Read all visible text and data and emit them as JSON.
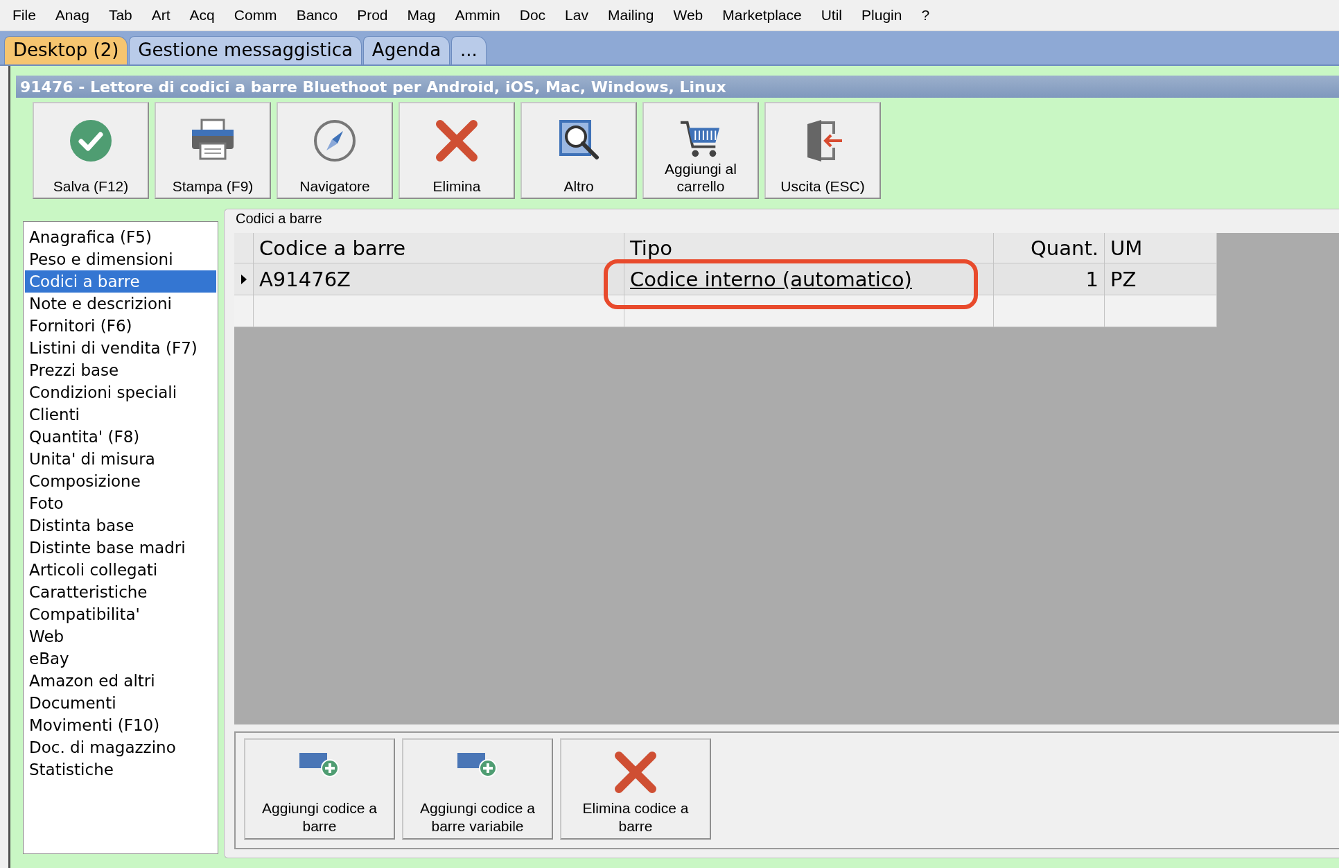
{
  "menu": [
    "File",
    "Anag",
    "Tab",
    "Art",
    "Acq",
    "Comm",
    "Banco",
    "Prod",
    "Mag",
    "Ammin",
    "Doc",
    "Lav",
    "Mailing",
    "Web",
    "Marketplace",
    "Util",
    "Plugin",
    "?"
  ],
  "tabs": [
    {
      "label": "Desktop (2)",
      "selected": true
    },
    {
      "label": "Gestione messaggistica",
      "selected": false
    },
    {
      "label": "Agenda",
      "selected": false
    },
    {
      "label": "...",
      "selected": false
    }
  ],
  "window": {
    "title": "91476 - Lettore di codici a barre Bluethoot  per Android, iOS, Mac, Windows, Linux"
  },
  "toolbar": [
    {
      "label": "Salva (F12)",
      "kind": "save"
    },
    {
      "label": "Stampa (F9)",
      "kind": "print"
    },
    {
      "label": "Navigatore",
      "kind": "compass"
    },
    {
      "label": "Elimina",
      "kind": "delete"
    },
    {
      "label": "Altro",
      "kind": "search"
    },
    {
      "label": "Aggiungi al carrello",
      "kind": "cart"
    },
    {
      "label": "Uscita (ESC)",
      "kind": "exit"
    }
  ],
  "sidebar": {
    "items": [
      {
        "label": "Anagrafica (F5)",
        "selected": false
      },
      {
        "label": "Peso e dimensioni",
        "selected": false
      },
      {
        "label": "Codici a barre",
        "selected": true
      },
      {
        "label": "Note e descrizioni",
        "selected": false
      },
      {
        "label": "Fornitori (F6)",
        "selected": false
      },
      {
        "label": "Listini di vendita (F7)",
        "selected": false
      },
      {
        "label": "Prezzi base",
        "selected": false
      },
      {
        "label": "Condizioni speciali",
        "selected": false
      },
      {
        "label": "Clienti",
        "selected": false
      },
      {
        "label": "Quantita' (F8)",
        "selected": false
      },
      {
        "label": "Unita' di misura",
        "selected": false
      },
      {
        "label": "Composizione",
        "selected": false
      },
      {
        "label": "Foto",
        "selected": false
      },
      {
        "label": "Distinta base",
        "selected": false
      },
      {
        "label": "Distinte base madri",
        "selected": false
      },
      {
        "label": "Articoli collegati",
        "selected": false
      },
      {
        "label": "Caratteristiche",
        "selected": false
      },
      {
        "label": "Compatibilita'",
        "selected": false
      },
      {
        "label": "Web",
        "selected": false
      },
      {
        "label": "eBay",
        "selected": false
      },
      {
        "label": "Amazon ed altri",
        "selected": false
      },
      {
        "label": "Documenti",
        "selected": false
      },
      {
        "label": "Movimenti (F10)",
        "selected": false
      },
      {
        "label": "Doc. di magazzino",
        "selected": false
      },
      {
        "label": "Statistiche",
        "selected": false
      }
    ]
  },
  "group": {
    "title": "Codici a barre"
  },
  "table": {
    "columns": [
      {
        "label": "Codice a barre"
      },
      {
        "label": "Tipo"
      },
      {
        "label": "Quant."
      },
      {
        "label": "UM"
      }
    ],
    "rows": [
      {
        "current": true,
        "cells": [
          {
            "text": "A91476Z"
          },
          {
            "text": "Codice interno (automatico)",
            "link": true,
            "highlighted": true
          },
          {
            "text": "1"
          },
          {
            "text": "PZ"
          }
        ]
      },
      {
        "current": false
      }
    ]
  },
  "bottom_buttons": [
    {
      "label": "Aggiungi codice a barre",
      "kind": "add"
    },
    {
      "label": "Aggiungi codice a barre variabile",
      "kind": "add"
    },
    {
      "label": "Elimina codice a barre",
      "kind": "delete"
    }
  ]
}
